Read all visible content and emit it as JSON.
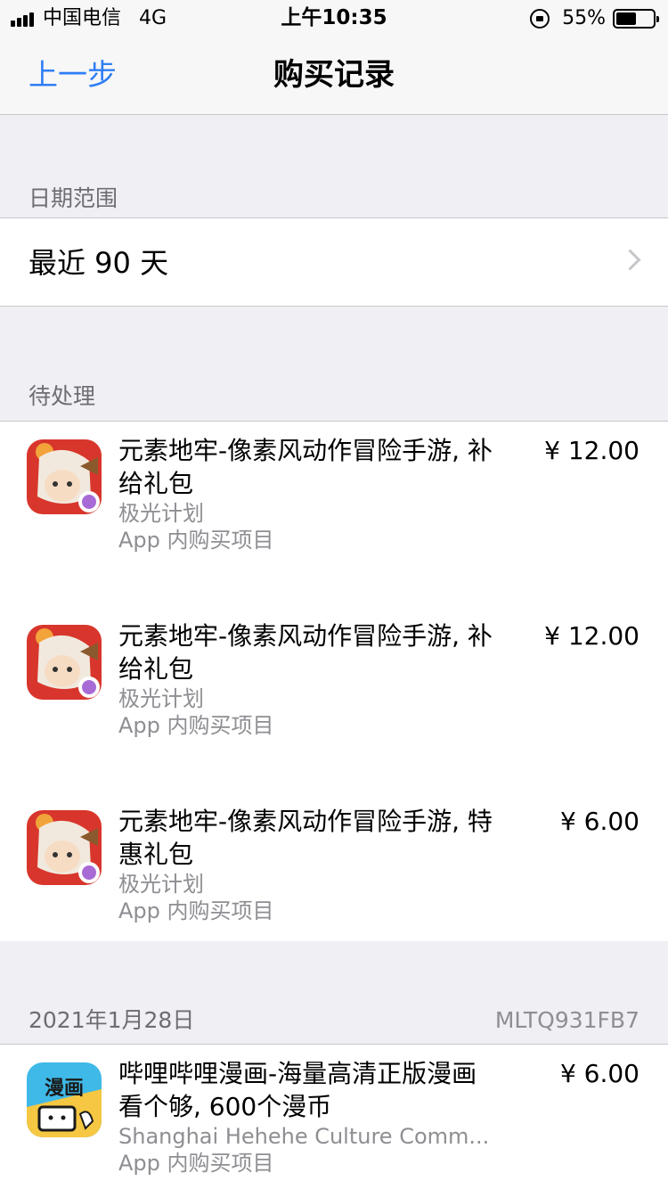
{
  "status_bar": {
    "carrier": "中国电信",
    "network": "4G",
    "time": "上午10:35",
    "battery_percent": "55%",
    "battery_level": 0.55
  },
  "nav": {
    "back_label": "上一步",
    "title": "购买记录"
  },
  "date_range": {
    "header": "日期范围",
    "value": "最近 90 天"
  },
  "pending": {
    "header": "待处理",
    "items": [
      {
        "title": "元素地牢-像素风动作冒险手游, 补给礼包",
        "developer": "极光计划",
        "type": "App 内购买项目",
        "price": "¥ 12.00",
        "icon": "yuansu-dungeon-icon"
      },
      {
        "title": "元素地牢-像素风动作冒险手游, 补给礼包",
        "developer": "极光计划",
        "type": "App 内购买项目",
        "price": "¥ 12.00",
        "icon": "yuansu-dungeon-icon"
      },
      {
        "title": "元素地牢-像素风动作冒险手游, 特惠礼包",
        "developer": "极光计划",
        "type": "App 内购买项目",
        "price": "¥ 6.00",
        "icon": "yuansu-dungeon-icon"
      }
    ]
  },
  "order": {
    "date": "2021年1月28日",
    "order_id": "MLTQ931FB7",
    "items": [
      {
        "title": "哔哩哔哩漫画-海量高清正版漫画看个够, 600个漫币",
        "developer": "Shanghai Hehehe Culture Comm...",
        "type": "App 内购买项目",
        "price": "¥ 6.00",
        "icon": "bilibili-manga-icon",
        "icon_text": "漫画"
      }
    ]
  },
  "colors": {
    "accent": "#2f7ef6",
    "background": "#efeff4",
    "secondary_text": "#8e8e93"
  }
}
